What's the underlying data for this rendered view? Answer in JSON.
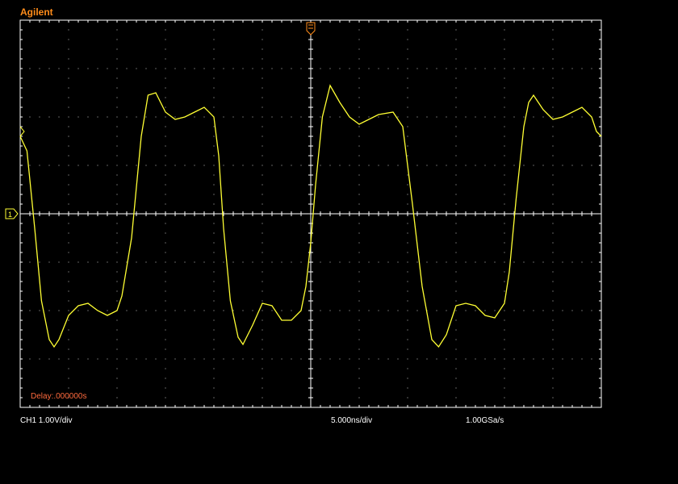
{
  "brand": "Agilent",
  "delay_label": "Delay:.000000s",
  "channel_scale": "CH1 1.00V/div",
  "time_scale": "5.000ns/div",
  "sample_rate": "1.00GSa/s",
  "channel_marker": "1",
  "colors": {
    "trace": "#ffff33",
    "grid": "#ffffff",
    "dots": "#bfbfbf",
    "brand": "#ff8c1a",
    "delay": "#ff6a3d",
    "trigger": "#ff8c1a",
    "marker": "#ffff33"
  },
  "icons": {
    "trigger": "trigger-arrow-icon",
    "channel": "channel-1-ground-marker-icon"
  },
  "chart_data": {
    "type": "line",
    "title": "",
    "xlabel": "",
    "ylabel": "",
    "x_unit": "ns",
    "y_unit": "V",
    "xlim": [
      -30,
      30
    ],
    "ylim": [
      -4,
      4
    ],
    "x_divisions": 12,
    "y_divisions": 8,
    "grid": true,
    "series": [
      {
        "values": [
          [
            -30,
            1.6
          ],
          [
            -29.3,
            1.3
          ],
          [
            -28.5,
            -0.3
          ],
          [
            -27.8,
            -1.8
          ],
          [
            -27.0,
            -2.6
          ],
          [
            -26.5,
            -2.75
          ],
          [
            -26.0,
            -2.6
          ],
          [
            -25.0,
            -2.1
          ],
          [
            -24.0,
            -1.9
          ],
          [
            -23.0,
            -1.85
          ],
          [
            -22.0,
            -2.0
          ],
          [
            -21.0,
            -2.1
          ],
          [
            -20.0,
            -2.0
          ],
          [
            -19.5,
            -1.7
          ],
          [
            -18.5,
            -0.5
          ],
          [
            -17.5,
            1.6
          ],
          [
            -16.8,
            2.45
          ],
          [
            -16.0,
            2.5
          ],
          [
            -15.0,
            2.1
          ],
          [
            -14.0,
            1.95
          ],
          [
            -13.0,
            2.0
          ],
          [
            -12.0,
            2.1
          ],
          [
            -11.0,
            2.2
          ],
          [
            -10.0,
            2.0
          ],
          [
            -9.5,
            1.2
          ],
          [
            -9.0,
            -0.3
          ],
          [
            -8.3,
            -1.8
          ],
          [
            -7.5,
            -2.55
          ],
          [
            -7.0,
            -2.7
          ],
          [
            -6.0,
            -2.3
          ],
          [
            -5.0,
            -1.85
          ],
          [
            -4.0,
            -1.9
          ],
          [
            -3.0,
            -2.2
          ],
          [
            -2.0,
            -2.2
          ],
          [
            -1.0,
            -2.0
          ],
          [
            -0.5,
            -1.5
          ],
          [
            0.0,
            -0.6
          ],
          [
            0.5,
            0.6
          ],
          [
            1.2,
            2.0
          ],
          [
            2.0,
            2.65
          ],
          [
            3.0,
            2.3
          ],
          [
            4.0,
            2.0
          ],
          [
            5.0,
            1.85
          ],
          [
            6.0,
            1.95
          ],
          [
            7.0,
            2.05
          ],
          [
            8.5,
            2.1
          ],
          [
            9.5,
            1.8
          ],
          [
            10.5,
            0.2
          ],
          [
            11.5,
            -1.5
          ],
          [
            12.5,
            -2.6
          ],
          [
            13.2,
            -2.75
          ],
          [
            14.0,
            -2.5
          ],
          [
            15.0,
            -1.9
          ],
          [
            16.0,
            -1.85
          ],
          [
            17.0,
            -1.9
          ],
          [
            18.0,
            -2.1
          ],
          [
            19.0,
            -2.15
          ],
          [
            20.0,
            -1.85
          ],
          [
            20.5,
            -1.2
          ],
          [
            21.2,
            0.3
          ],
          [
            22.0,
            1.8
          ],
          [
            22.5,
            2.3
          ],
          [
            23.0,
            2.45
          ],
          [
            24.0,
            2.15
          ],
          [
            25.0,
            1.95
          ],
          [
            26.0,
            2.0
          ],
          [
            27.0,
            2.1
          ],
          [
            28.0,
            2.2
          ],
          [
            29.0,
            2.0
          ],
          [
            29.5,
            1.7
          ],
          [
            30,
            1.6
          ]
        ]
      }
    ]
  }
}
